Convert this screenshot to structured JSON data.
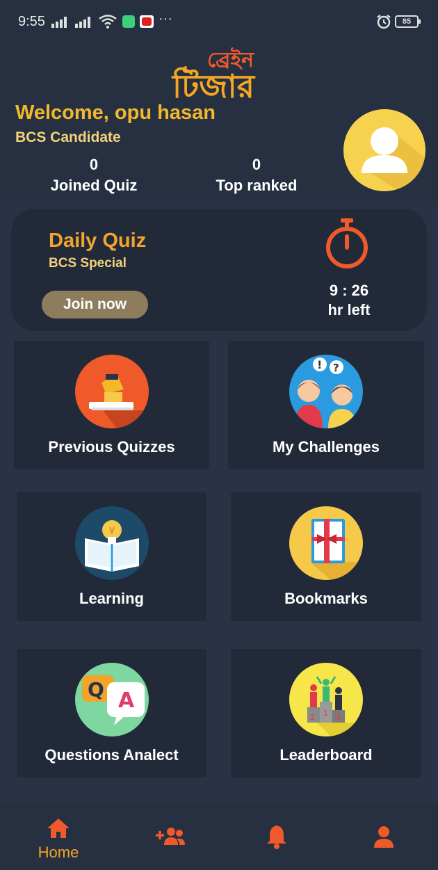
{
  "status_bar": {
    "time": "9:55",
    "dots": "···",
    "battery": "85"
  },
  "header": {
    "logo_text_top": "ব্রেইন",
    "logo_text_bottom": "টিজার",
    "welcome": "Welcome, opu hasan",
    "role": "BCS Candidate",
    "stats": [
      {
        "value": "0",
        "label": "Joined Quiz"
      },
      {
        "value": "0",
        "label": "Top ranked"
      }
    ]
  },
  "daily_quiz": {
    "title": "Daily Quiz",
    "subtitle": "BCS Special",
    "button_label": "Join now",
    "time": "9 : 26",
    "time_suffix": "hr left"
  },
  "tiles": [
    {
      "label": "Previous Quizzes",
      "icon": "lamp-book-icon"
    },
    {
      "label": "My Challenges",
      "icon": "people-question-icon"
    },
    {
      "label": "Learning",
      "icon": "lightbulb-book-icon"
    },
    {
      "label": "Bookmarks",
      "icon": "bookmark-book-icon"
    },
    {
      "label": "Questions Analect",
      "icon": "qa-bubbles-icon"
    },
    {
      "label": "Leaderboard",
      "icon": "podium-icon"
    }
  ],
  "bottom_nav": {
    "home_label": "Home",
    "items": [
      "home-icon",
      "add-friends-icon",
      "notification-bell-icon",
      "profile-icon"
    ]
  },
  "colors": {
    "background": "#2a3346",
    "accent": "#f2a52a",
    "nav_icon": "#f05a2a"
  }
}
